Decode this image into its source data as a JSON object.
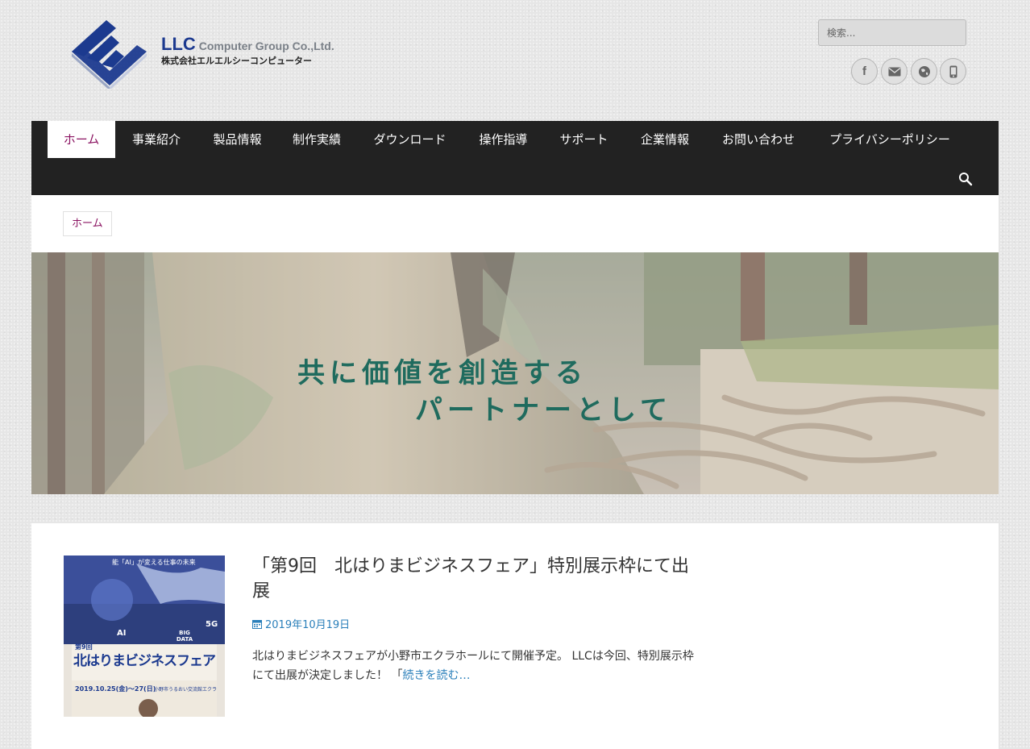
{
  "header": {
    "logo_en_mark": "LLC",
    "logo_en": "Computer Group Co.,Ltd.",
    "logo_ja": "株式会社エルエルシーコンピューター",
    "search_placeholder": "検索...",
    "social": [
      {
        "icon": "facebook-icon",
        "glyph": "f"
      },
      {
        "icon": "mail-icon",
        "glyph": "✉"
      },
      {
        "icon": "globe-icon",
        "glyph": "⊕"
      },
      {
        "icon": "phone-icon",
        "glyph": "▯"
      }
    ]
  },
  "nav": {
    "items": [
      "ホーム",
      "事業紹介",
      "製品情報",
      "制作実績",
      "ダウンロード",
      "操作指導",
      "サポート",
      "企業情報",
      "お問い合わせ",
      "プライバシーポリシー"
    ],
    "active_index": 0,
    "search_icon": "search-icon"
  },
  "breadcrumb": {
    "home": "ホーム"
  },
  "hero": {
    "line1": "共に価値を創造する",
    "line2": "パートナーとして"
  },
  "post": {
    "title": "「第9回　北はりまビジネスフェア」特別展示枠にて出展",
    "date": "2019年10月19日",
    "excerpt": "北はりまビジネスフェアが小野市エクラホールにて開催予定。 LLCは今回、特別展示枠にて出展が決定しました！ 「",
    "read_more": "続きを読む…",
    "thumb": {
      "title": "北はりまビジネスフェア",
      "edition": "第9回",
      "dates": "2019.10.25(金)〜27(日)",
      "venue": "小野市うるおい交流館エクラ",
      "tags": [
        "AI",
        "BIG DATA",
        "5G"
      ],
      "headline": "能「AI」が変える仕事の未来"
    }
  },
  "colors": {
    "nav_bg": "#222222",
    "active": "#8b1462",
    "link": "#2a7fba",
    "hero_text": "#1f6b5e"
  }
}
